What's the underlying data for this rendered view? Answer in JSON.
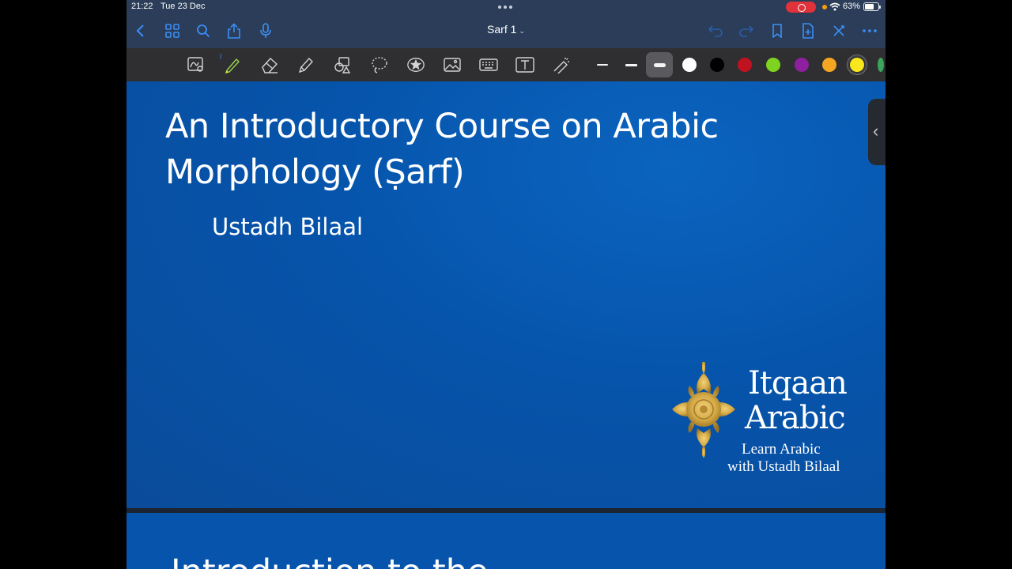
{
  "status_bar": {
    "time": "21:22",
    "date": "Tue 23 Dec",
    "battery": "63%"
  },
  "nav": {
    "doc_title": "Sarf 1",
    "icons": [
      "back-icon",
      "grid-icon",
      "search-icon",
      "share-icon",
      "microphone-icon",
      "undo-icon",
      "redo-icon",
      "bookmark-icon",
      "add-page-icon",
      "close-icon",
      "more-icon"
    ]
  },
  "toolbar": {
    "tools": [
      "lasso-ink-icon",
      "pen-icon",
      "eraser-icon",
      "highlighter-icon",
      "shapes-icon",
      "lasso-icon",
      "sticker-icon",
      "image-icon",
      "keyboard-icon",
      "textbox-icon",
      "laser-pointer-icon"
    ],
    "colors": [
      "#ffffff",
      "#000000",
      "#c1121f",
      "#7ed321",
      "#8e1f9e",
      "#f5a623",
      "#f8e71c"
    ],
    "selected_color": "#f8e71c"
  },
  "slide": {
    "title_line1": "An Introductory Course on Arabic",
    "title_line2": "Morphology (Ṣarf)",
    "subtitle": "Ustadh Bilaal",
    "logo_name1": "Itqaan",
    "logo_name2": "Arabic",
    "logo_tag1": "Learn Arabic",
    "logo_tag2": "with Ustadh Bilaal",
    "background": "#0654ab",
    "logo_gold": "#d4a845"
  },
  "slide2": {
    "title_partial": "Introduction to the"
  }
}
